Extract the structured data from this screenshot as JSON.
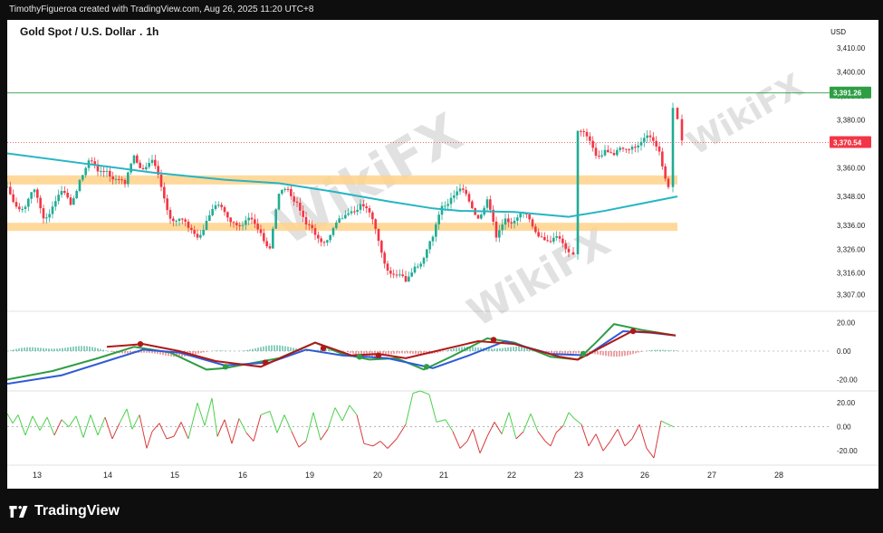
{
  "header": {
    "caption": "TimothyFigueroa created with TradingView.com, Aug 26, 2025 11:20 UTC+8"
  },
  "symbol": {
    "name": "Gold Spot / U.S. Dollar",
    "sep": ".",
    "interval": "1h"
  },
  "currency": "USD",
  "footer": {
    "brand": "TradingView",
    "logo_icon": "tradingview-logo-icon"
  },
  "watermark": {
    "text": "WikiFX"
  },
  "colors": {
    "up": "#22ab94",
    "down": "#f23645",
    "ema": "#26b5c2",
    "zone": "#ffd28a",
    "green_line": "#2e9e44",
    "red_line": "#b01818",
    "blue_line": "#2f5bd6"
  },
  "chart_data": [
    {
      "type": "candlestick",
      "title": "Gold Spot / U.S. Dollar . 1h",
      "currency": "USD",
      "ylim": [
        3300,
        3418
      ],
      "y_ticks": [
        "3,410.00",
        "3,400.00",
        "3,390.00",
        "3,380.00",
        "3,360.00",
        "3,348.00",
        "3,336.00",
        "3,326.00",
        "3,316.00",
        "3,307.00"
      ],
      "x_ticks": [
        "13",
        "14",
        "15",
        "16",
        "19",
        "20",
        "21",
        "22",
        "23",
        "26",
        "27",
        "28"
      ],
      "price_labels": [
        {
          "value": "3,391.26",
          "color": "#2e9e44"
        },
        {
          "value": "3,370.54",
          "color": "#f23645"
        }
      ],
      "zones": [
        {
          "from": 3353.0,
          "to": 3356.8
        },
        {
          "from": 3333.6,
          "to": 3337.0
        }
      ],
      "ema_series": [
        [
          0,
          3366
        ],
        [
          80,
          3362
        ],
        [
          160,
          3358
        ],
        [
          240,
          3355
        ],
        [
          300,
          3353.5
        ],
        [
          360,
          3350
        ],
        [
          420,
          3346
        ],
        [
          470,
          3343
        ],
        [
          500,
          3342
        ],
        [
          560,
          3341.5
        ],
        [
          620,
          3339.5
        ],
        [
          660,
          3342
        ],
        [
          700,
          3345
        ],
        [
          740,
          3348
        ]
      ],
      "candles_path": [
        [
          0,
          3352
        ],
        [
          10,
          3345
        ],
        [
          20,
          3343
        ],
        [
          30,
          3350
        ],
        [
          40,
          3340
        ],
        [
          50,
          3344
        ],
        [
          60,
          3349
        ],
        [
          70,
          3345
        ],
        [
          80,
          3356
        ],
        [
          90,
          3362
        ],
        [
          100,
          3358
        ],
        [
          110,
          3360
        ],
        [
          120,
          3355
        ],
        [
          130,
          3352
        ],
        [
          140,
          3366
        ],
        [
          150,
          3360
        ],
        [
          160,
          3362
        ],
        [
          170,
          3352
        ],
        [
          180,
          3340
        ],
        [
          190,
          3338
        ],
        [
          200,
          3334
        ],
        [
          210,
          3332
        ],
        [
          220,
          3338
        ],
        [
          230,
          3343
        ],
        [
          240,
          3342
        ],
        [
          250,
          3338
        ],
        [
          260,
          3335
        ],
        [
          270,
          3338
        ],
        [
          280,
          3334
        ],
        [
          290,
          3326
        ],
        [
          300,
          3348
        ],
        [
          310,
          3352
        ],
        [
          320,
          3346
        ],
        [
          330,
          3335
        ],
        [
          340,
          3332
        ],
        [
          350,
          3330
        ],
        [
          360,
          3334
        ],
        [
          370,
          3338
        ],
        [
          380,
          3343
        ],
        [
          390,
          3345
        ],
        [
          400,
          3340
        ],
        [
          410,
          3330
        ],
        [
          420,
          3318
        ],
        [
          430,
          3314
        ],
        [
          440,
          3312
        ],
        [
          450,
          3320
        ],
        [
          460,
          3322
        ],
        [
          470,
          3330
        ],
        [
          480,
          3345
        ],
        [
          490,
          3348
        ],
        [
          500,
          3350
        ],
        [
          510,
          3346
        ],
        [
          520,
          3340
        ],
        [
          530,
          3346
        ],
        [
          540,
          3330
        ],
        [
          550,
          3340
        ],
        [
          560,
          3338
        ],
        [
          570,
          3340
        ],
        [
          580,
          3336
        ],
        [
          590,
          3332
        ],
        [
          600,
          3328
        ],
        [
          610,
          3330
        ],
        [
          620,
          3326
        ],
        [
          625,
          3323
        ],
        [
          630,
          3375
        ],
        [
          640,
          3372
        ],
        [
          650,
          3366
        ],
        [
          660,
          3368
        ],
        [
          670,
          3364
        ],
        [
          680,
          3368
        ],
        [
          690,
          3370
        ],
        [
          700,
          3370
        ],
        [
          710,
          3372
        ],
        [
          720,
          3368
        ],
        [
          730,
          3352
        ],
        [
          735,
          3386
        ],
        [
          740,
          3379
        ],
        [
          745,
          3372
        ]
      ]
    },
    {
      "type": "line",
      "name": "MACD-style oscillator",
      "ylim": [
        -28,
        28
      ],
      "y_ticks": [
        "20.00",
        "0.00",
        "-20.00"
      ],
      "series": [
        {
          "name": "",
          "color": "#2e9e44",
          "values": [
            [
              0,
              -20
            ],
            [
              50,
              -14
            ],
            [
              100,
              -5
            ],
            [
              140,
              3
            ],
            [
              180,
              -1
            ],
            [
              220,
              -13
            ],
            [
              240,
              -12
            ],
            [
              300,
              -5
            ],
            [
              340,
              6
            ],
            [
              370,
              -2
            ],
            [
              400,
              -6
            ],
            [
              430,
              -5
            ],
            [
              460,
              -13
            ],
            [
              490,
              -4
            ],
            [
              530,
              9
            ],
            [
              560,
              6
            ],
            [
              600,
              -4
            ],
            [
              630,
              -6
            ],
            [
              650,
              6
            ],
            [
              670,
              19
            ],
            [
              700,
              15
            ],
            [
              738,
              11
            ]
          ]
        },
        {
          "name": "",
          "color": "#2f5bd6",
          "values": [
            [
              0,
              -23
            ],
            [
              60,
              -17
            ],
            [
              110,
              -7
            ],
            [
              150,
              1
            ],
            [
              190,
              -1
            ],
            [
              240,
              -10
            ],
            [
              290,
              -8
            ],
            [
              330,
              1
            ],
            [
              370,
              -3
            ],
            [
              420,
              -5
            ],
            [
              470,
              -12
            ],
            [
              510,
              -3
            ],
            [
              550,
              7
            ],
            [
              600,
              -2
            ],
            [
              640,
              -3
            ],
            [
              680,
              14
            ],
            [
              710,
              13
            ],
            [
              738,
              11
            ]
          ]
        },
        {
          "name": "",
          "color": "#b01818",
          "values": [
            [
              110,
              3
            ],
            [
              150,
              5
            ],
            [
              190,
              0
            ],
            [
              230,
              -7
            ],
            [
              280,
              -11
            ],
            [
              340,
              6
            ],
            [
              380,
              -3
            ],
            [
              410,
              -2
            ],
            [
              440,
              -5
            ],
            [
              520,
              7
            ],
            [
              560,
              5
            ],
            [
              610,
              -4
            ],
            [
              630,
              -6
            ],
            [
              690,
              14
            ],
            [
              715,
              13
            ],
            [
              738,
              11
            ]
          ]
        }
      ],
      "dots": [
        {
          "x": 147,
          "v": 5,
          "color": "#b01818"
        },
        {
          "x": 241,
          "v": -11,
          "color": "#2e9e44"
        },
        {
          "x": 285,
          "v": -8,
          "color": "#b01818"
        },
        {
          "x": 349,
          "v": 2,
          "color": "#b01818"
        },
        {
          "x": 389,
          "v": -4,
          "color": "#2e9e44"
        },
        {
          "x": 410,
          "v": -3,
          "color": "#b01818"
        },
        {
          "x": 463,
          "v": -11,
          "color": "#2e9e44"
        },
        {
          "x": 537,
          "v": 8,
          "color": "#b01818"
        },
        {
          "x": 636,
          "v": -2,
          "color": "#2e9e44"
        },
        {
          "x": 691,
          "v": 14,
          "color": "#b01818"
        }
      ]
    },
    {
      "type": "line",
      "name": "Momentum oscillator",
      "ylim": [
        -32,
        30
      ],
      "y_ticks": [
        "20.00",
        "0.00",
        "-20.00"
      ],
      "series": [
        {
          "name": "",
          "values": [
            [
              0,
              11
            ],
            [
              6,
              3
            ],
            [
              12,
              10
            ],
            [
              20,
              -7
            ],
            [
              28,
              9
            ],
            [
              36,
              -3
            ],
            [
              44,
              8
            ],
            [
              52,
              -7
            ],
            [
              60,
              6
            ],
            [
              68,
              0
            ],
            [
              76,
              9
            ],
            [
              84,
              -9
            ],
            [
              92,
              10
            ],
            [
              100,
              -7
            ],
            [
              108,
              8
            ],
            [
              116,
              -10
            ],
            [
              124,
              3
            ],
            [
              132,
              15
            ],
            [
              138,
              -2
            ],
            [
              146,
              10
            ],
            [
              154,
              -18
            ],
            [
              160,
              -4
            ],
            [
              168,
              3
            ],
            [
              176,
              -10
            ],
            [
              184,
              -8
            ],
            [
              192,
              4
            ],
            [
              200,
              -10
            ],
            [
              210,
              20
            ],
            [
              218,
              1
            ],
            [
              226,
              24
            ],
            [
              232,
              -8
            ],
            [
              240,
              6
            ],
            [
              248,
              -14
            ],
            [
              256,
              7
            ],
            [
              264,
              -5
            ],
            [
              272,
              -12
            ],
            [
              280,
              10
            ],
            [
              290,
              13
            ],
            [
              298,
              -5
            ],
            [
              306,
              10
            ],
            [
              314,
              -4
            ],
            [
              322,
              -17
            ],
            [
              330,
              -12
            ],
            [
              338,
              12
            ],
            [
              346,
              -11
            ],
            [
              354,
              -2
            ],
            [
              362,
              16
            ],
            [
              370,
              5
            ],
            [
              378,
              18
            ],
            [
              386,
              10
            ],
            [
              394,
              -14
            ],
            [
              404,
              -16
            ],
            [
              412,
              -12
            ],
            [
              420,
              -18
            ],
            [
              430,
              -10
            ],
            [
              440,
              2
            ],
            [
              448,
              28
            ],
            [
              456,
              30
            ],
            [
              466,
              27
            ],
            [
              474,
              4
            ],
            [
              484,
              6
            ],
            [
              492,
              -4
            ],
            [
              500,
              -18
            ],
            [
              508,
              -12
            ],
            [
              514,
              -2
            ],
            [
              522,
              -22
            ],
            [
              530,
              -8
            ],
            [
              538,
              4
            ],
            [
              546,
              -6
            ],
            [
              554,
              12
            ],
            [
              562,
              -10
            ],
            [
              570,
              -4
            ],
            [
              578,
              11
            ],
            [
              586,
              -4
            ],
            [
              594,
              -12
            ],
            [
              600,
              -16
            ],
            [
              606,
              -5
            ],
            [
              614,
              1
            ],
            [
              620,
              12
            ],
            [
              626,
              7
            ],
            [
              634,
              2
            ],
            [
              642,
              -16
            ],
            [
              650,
              -6
            ],
            [
              658,
              -20
            ],
            [
              666,
              -12
            ],
            [
              674,
              -2
            ],
            [
              682,
              -16
            ],
            [
              690,
              -10
            ],
            [
              698,
              2
            ],
            [
              706,
              -18
            ],
            [
              714,
              -26
            ],
            [
              722,
              5
            ],
            [
              730,
              2
            ],
            [
              736,
              0
            ]
          ]
        }
      ]
    }
  ]
}
